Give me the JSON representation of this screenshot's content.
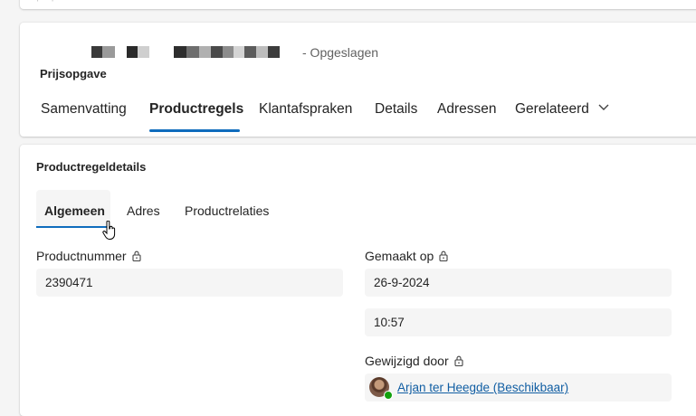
{
  "header": {
    "saved_status": "- Opgeslagen",
    "entity_type": "Prijsopgave"
  },
  "tabs": [
    {
      "label": "Samenvatting",
      "active": false
    },
    {
      "label": "Productregels",
      "active": true
    },
    {
      "label": "Klantafspraken",
      "active": false
    },
    {
      "label": "Details",
      "active": false
    },
    {
      "label": "Adressen",
      "active": false
    },
    {
      "label": "Gerelateerd",
      "active": false
    }
  ],
  "details": {
    "title": "Productregeldetails",
    "subtabs": [
      {
        "label": "Algemeen",
        "active": true
      },
      {
        "label": "Adres",
        "active": false
      },
      {
        "label": "Productrelaties",
        "active": false
      }
    ],
    "product_number": {
      "label": "Productnummer",
      "value": "2390471"
    },
    "created_on": {
      "label": "Gemaakt op",
      "date": "26-9-2024",
      "time": "10:57"
    },
    "modified_by": {
      "label": "Gewijzigd door",
      "user": "Arjan ter Heegde (Beschikbaar)",
      "presence_color": "#13a10e"
    }
  },
  "colors": {
    "accent": "#0f6cbd",
    "link": "#115ea3"
  }
}
